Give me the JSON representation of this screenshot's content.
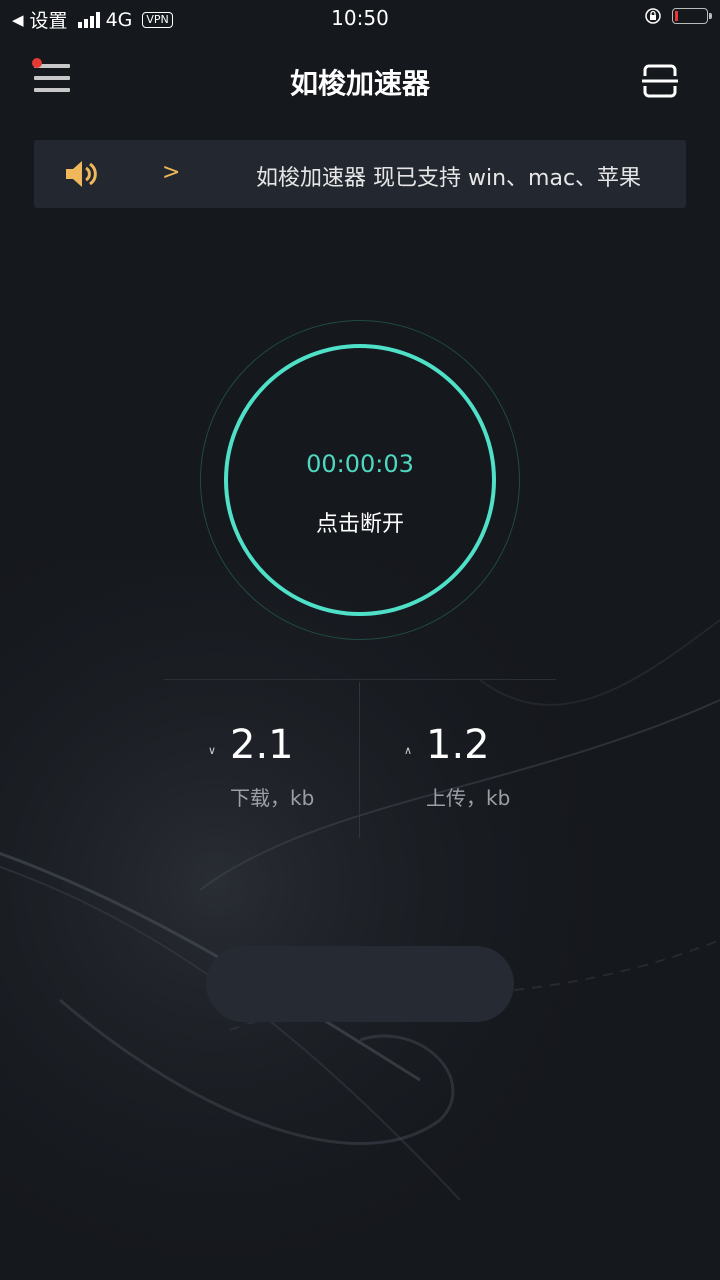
{
  "status_bar": {
    "back_label": "设置",
    "network": "4G",
    "vpn": "VPN",
    "time": "10:50"
  },
  "nav": {
    "title": "如梭加速器"
  },
  "notice": {
    "arrow": ">",
    "text": "如梭加速器 现已支持 win、mac、苹果"
  },
  "connection": {
    "timer": "00:00:03",
    "action_label": "点击断开"
  },
  "stats": {
    "download": {
      "arrow": "∨",
      "value": "2.1",
      "label": "下载，kb"
    },
    "upload": {
      "arrow": "∧",
      "value": "1.2",
      "label": "上传，kb"
    }
  },
  "colors": {
    "background": "#15181d",
    "accent": "#4fe0c8",
    "notice_arrow": "#f0b85a",
    "battery_low": "#e53935"
  },
  "icons": {
    "menu": "hamburger-menu-icon",
    "scan": "scan-icon",
    "speaker": "speaker-icon"
  }
}
